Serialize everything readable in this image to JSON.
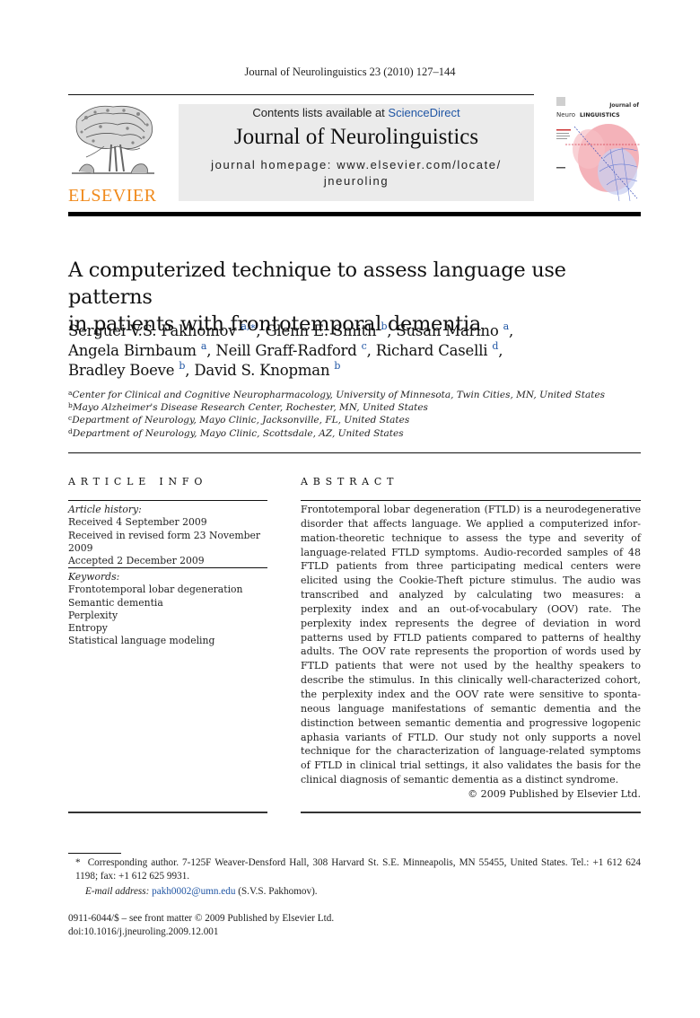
{
  "running_head": "Journal of Neurolinguistics 23 (2010) 127–144",
  "publisher": {
    "logo_word": "ELSEVIER",
    "logo_icon": "elsevier-tree-icon",
    "brand_color": "#f08a1c"
  },
  "masthead": {
    "contents_prefix": "Contents lists available at ",
    "contents_link": "ScienceDirect",
    "journal_title": "Journal of Neurolinguistics",
    "homepage_label": "journal homepage: www.elsevier.com/locate/",
    "homepage_suffix": "jneuroling",
    "link_color": "#1f55a4"
  },
  "cover": {
    "journal_of": "Journal of",
    "neuro": "Neuro",
    "linguistics": "LINGUISTICS"
  },
  "article": {
    "title_line1": "A computerized technique to assess language use patterns",
    "title_line2": "in patients with frontotemporal dementia",
    "authors": [
      {
        "name": "Serguei V.S. Pakhomov",
        "sup": "a,∗",
        "sep": ", "
      },
      {
        "name": "Glenn E. Smith",
        "sup": "b",
        "sep": ", "
      },
      {
        "name": "Susan Marino",
        "sup": "a",
        "sep": ","
      },
      {
        "name": "Angela Birnbaum",
        "sup": "a",
        "sep": ", "
      },
      {
        "name": "Neill Graff-Radford",
        "sup": "c",
        "sep": ", "
      },
      {
        "name": "Richard Caselli",
        "sup": "d",
        "sep": ","
      },
      {
        "name": "Bradley Boeve",
        "sup": "b",
        "sep": ", "
      },
      {
        "name": "David S. Knopman",
        "sup": "b",
        "sep": ""
      }
    ],
    "affiliations": [
      {
        "key": "a",
        "text": "Center for Clinical and Cognitive Neuropharmacology, University of Minnesota, Twin Cities, MN, United States"
      },
      {
        "key": "b",
        "text": "Mayo Alzheimer's Disease Research Center, Rochester, MN, United States"
      },
      {
        "key": "c",
        "text": "Department of Neurology, Mayo Clinic, Jacksonville, FL, United States"
      },
      {
        "key": "d",
        "text": "Department of Neurology, Mayo Clinic, Scottsdale, AZ, United States"
      }
    ]
  },
  "article_info": {
    "heading": "ARTICLE INFO",
    "history_label": "Article history:",
    "history": [
      "Received 4 September 2009",
      "Received in revised form 23 November 2009",
      "Accepted 2 December 2009"
    ],
    "keywords_label": "Keywords:",
    "keywords": [
      "Frontotemporal lobar degeneration",
      "Semantic dementia",
      "Perplexity",
      "Entropy",
      "Statistical language modeling"
    ]
  },
  "abstract": {
    "heading": "ABSTRACT",
    "text": "Frontotemporal lobar degeneration (FTLD) is a neurodegenerative disorder that affects language. We applied a computerized infor­mation-theoretic technique to assess the type and severity of language-related FTLD symptoms. Audio-recorded samples of 48 FTLD patients from three participating medical centers were elicited using the Cookie-Theft picture stimulus. The audio was transcribed and analyzed by calculating two measures: a perplexity index and an out-of-vocabulary (OOV) rate. The perplexity index represents the degree of deviation in word patterns used by FTLD patients compared to patterns of healthy adults. The OOV rate represents the proportion of words used by FTLD patients that were not used by the healthy speakers to describe the stimulus. In this clinically well-characterized cohort, the perplexity index and the OOV rate were sensitive to sponta­neous language manifestations of semantic dementia and the distinction between semantic dementia and progressive logopenic aphasia variants of FTLD. Our study not only supports a novel technique for the characterization of language-related symptoms of FTLD in clinical trial settings, it also validates the basis for the clinical diagnosis of semantic dementia as a distinct syndrome.",
    "copyright": "© 2009 Published by Elsevier Ltd."
  },
  "footnote": {
    "marker": "*",
    "text": "Corresponding author. 7-125F Weaver-Densford Hall, 308 Harvard St. S.E. Minneapolis, MN 55455, United States. Tel.: +1 612 624 1198; fax: +1 612 625 9931.",
    "email_label": "E-mail address:",
    "email": "pakh0002@umn.edu",
    "email_owner": "(S.V.S. Pakhomov)."
  },
  "front_matter": {
    "issn_line": "0911-6044/$ – see front matter © 2009 Published by Elsevier Ltd.",
    "doi": "doi:10.1016/j.jneuroling.2009.12.001"
  }
}
